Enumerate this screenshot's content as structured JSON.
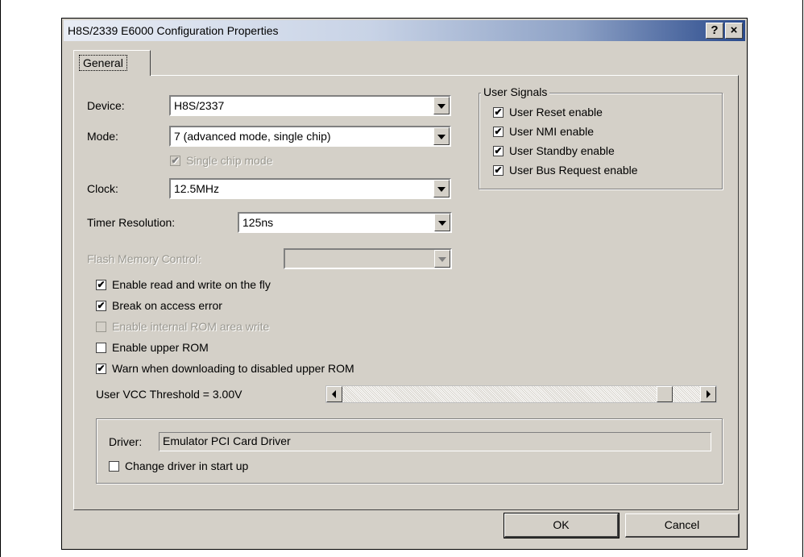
{
  "window": {
    "title": "H8S/2339 E6000 Configuration Properties",
    "help_btn": "?",
    "close_btn": "×"
  },
  "tabs": [
    {
      "label": "General"
    }
  ],
  "general": {
    "device": {
      "label": "Device:",
      "value": "H8S/2337"
    },
    "mode": {
      "label": "Mode:",
      "value": "7 (advanced mode, single chip)"
    },
    "single_chip": {
      "label": "Single chip mode",
      "checked": true,
      "enabled": false
    },
    "clock": {
      "label": "Clock:",
      "value": "12.5MHz"
    },
    "timer_resolution": {
      "label": "Timer Resolution:",
      "value": "125ns"
    },
    "flash_memory_control": {
      "label": "Flash Memory Control:",
      "value": "",
      "enabled": false
    },
    "options": [
      {
        "label": "Enable read and write on the fly",
        "checked": true,
        "enabled": true
      },
      {
        "label": "Break on access error",
        "checked": true,
        "enabled": true
      },
      {
        "label": "Enable internal ROM area write",
        "checked": false,
        "enabled": false
      },
      {
        "label": "Enable upper ROM",
        "checked": false,
        "enabled": true
      },
      {
        "label": "Warn when downloading to disabled upper ROM",
        "checked": true,
        "enabled": true
      }
    ],
    "vcc_threshold": {
      "label": "User VCC Threshold = 3.00V",
      "position": 0.92
    }
  },
  "user_signals": {
    "title": "User Signals",
    "items": [
      {
        "label": "User Reset enable",
        "checked": true
      },
      {
        "label": "User NMI enable",
        "checked": true
      },
      {
        "label": "User Standby enable",
        "checked": true
      },
      {
        "label": "User Bus Request enable",
        "checked": true
      }
    ]
  },
  "driver": {
    "label": "Driver:",
    "value": "Emulator PCI Card Driver",
    "change_on_startup": {
      "label": "Change driver in start up",
      "checked": false
    }
  },
  "buttons": {
    "ok": "OK",
    "cancel": "Cancel"
  },
  "glyphs": {
    "check": "✔"
  }
}
